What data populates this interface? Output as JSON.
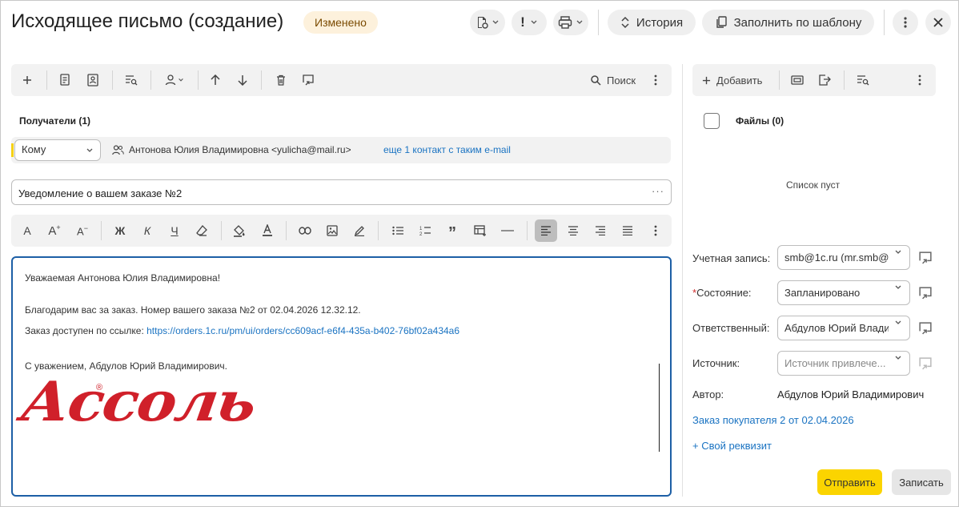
{
  "header": {
    "title": "Исходящее письмо (создание)",
    "status": "Изменено",
    "history_label": "История",
    "template_label": "Заполнить по шаблону"
  },
  "toolbar": {
    "search_label": "Поиск"
  },
  "recipients": {
    "title": "Получатели (1)",
    "type_value": "Кому",
    "contact": "Антонова Юлия Владимировна <yulicha@mail.ru>",
    "more_link": "еще 1 контакт с таким e-mail"
  },
  "subject": {
    "value": "Уведомление о вашем заказе №2",
    "more": "···"
  },
  "format_toolbar": {
    "bold": "Ж",
    "italic": "К",
    "underline": "Ч",
    "font": "A"
  },
  "body": {
    "greeting": "Уважаемая Антонова Юлия Владимировна!",
    "line1": "Благодарим вас за заказ. Номер вашего заказа №2 от 02.04.2026 12.32.12.",
    "line2_prefix": "Заказ доступен по ссылке: ",
    "line2_link": "https://orders.1c.ru/pm/ui/orders/cc609acf-e6f4-435a-b402-76bf02a434a6",
    "signature": "С уважением, Абдулов Юрий Владимирович.",
    "logo_text": "Ассоль",
    "logo_mark": "®",
    "logo_color": "#d0202a"
  },
  "files": {
    "add_label": "Добавить",
    "title": "Файлы (0)",
    "empty": "Список пуст"
  },
  "props": {
    "account_label": "Учетная запись:",
    "account_value": "smb@1c.ru (mr.smb@l",
    "state_req": "*",
    "state_label": "Состояние:",
    "state_value": "Запланировано",
    "responsible_label": "Ответственный:",
    "responsible_value": "Абдулов Юрий Влади",
    "source_label": "Источник:",
    "source_placeholder": "Источник привлече...",
    "author_label": "Автор:",
    "author_value": "Абдулов Юрий Владимирович",
    "order_link": "Заказ покупателя 2 от 02.04.2026",
    "custom_link": "+ Свой реквизит"
  },
  "actions": {
    "send": "Отправить",
    "save": "Записать"
  },
  "colors": {
    "accent": "#fbd400",
    "link": "#1a73c2",
    "focus": "#1d5fa6",
    "badge_bg": "#fdf1dc"
  }
}
